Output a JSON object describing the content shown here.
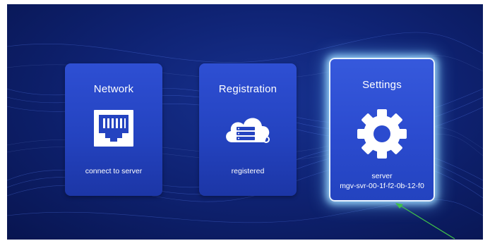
{
  "cards": [
    {
      "title": "Network",
      "subtitle": "connect to server",
      "icon": "ethernet-port-icon"
    },
    {
      "title": "Registration",
      "subtitle": "registered",
      "icon": "cloud-server-key-icon"
    },
    {
      "title": "Settings",
      "subtitle_line1": "server",
      "subtitle_line2": "mgv-svr-00-1f-f2-0b-12-f0",
      "icon": "gear-icon",
      "selected": true
    }
  ],
  "annotation": {
    "arrow_color": "#3fbf4a",
    "icon": "green-arrow-pointer"
  },
  "colors": {
    "background": "#0f2374",
    "card": "#2443c0",
    "selected_glow": "#a0dcff"
  }
}
